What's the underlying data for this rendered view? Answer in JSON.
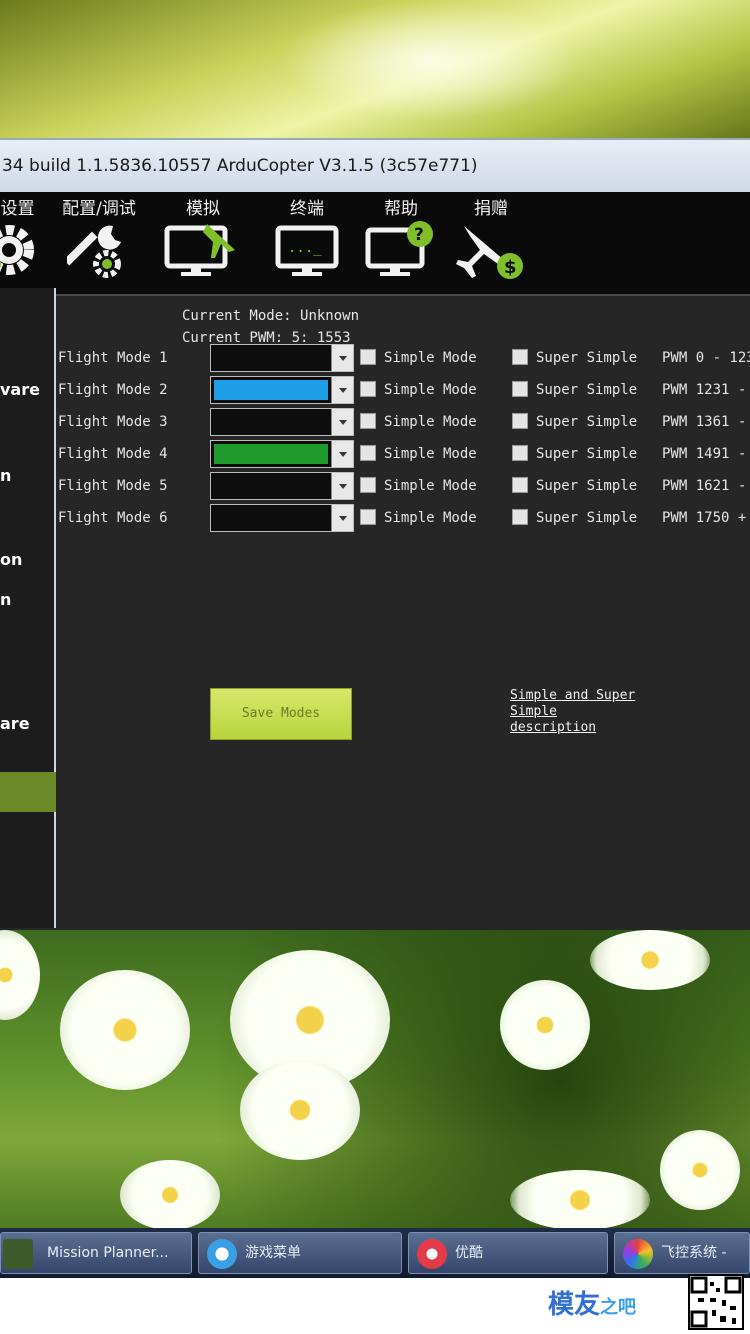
{
  "window": {
    "title": "34 build 1.1.5836.10557 ArduCopter V3.1.5 (3c57e771)"
  },
  "menu": {
    "items": [
      {
        "label": "台设置",
        "icon": "gear-icon"
      },
      {
        "label": "配置/调试",
        "icon": "wrench-gear-icon"
      },
      {
        "label": "模拟",
        "icon": "monitor-plane-icon"
      },
      {
        "label": "终端",
        "icon": "monitor-terminal-icon"
      },
      {
        "label": "帮助",
        "icon": "monitor-help-icon"
      },
      {
        "label": "捐赠",
        "icon": "plane-dollar-icon"
      }
    ]
  },
  "sidebar": {
    "items": [
      "vare",
      "n",
      "on",
      "n",
      "are"
    ]
  },
  "status": {
    "current_mode_label": "Current Mode:",
    "current_mode_value": "Unknown",
    "current_pwm_label": "Current PWM:",
    "current_pwm_value": "5: 1553"
  },
  "modes": [
    {
      "label": "Flight Mode 1",
      "simple": "Simple Mode",
      "super_simple": "Super Simple",
      "pwm": "PWM 0 - 123",
      "fill": "#0d0d0d"
    },
    {
      "label": "Flight Mode 2",
      "simple": "Simple Mode",
      "super_simple": "Super Simple",
      "pwm": "PWM 1231 -",
      "fill": "#1e9ee6"
    },
    {
      "label": "Flight Mode 3",
      "simple": "Simple Mode",
      "super_simple": "Super Simple",
      "pwm": "PWM 1361 -",
      "fill": "#0d0d0d"
    },
    {
      "label": "Flight Mode 4",
      "simple": "Simple Mode",
      "super_simple": "Super Simple",
      "pwm": "PWM 1491 -",
      "fill": "#1f9a2c"
    },
    {
      "label": "Flight Mode 5",
      "simple": "Simple Mode",
      "super_simple": "Super Simple",
      "pwm": "PWM 1621 -",
      "fill": "#0d0d0d"
    },
    {
      "label": "Flight Mode 6",
      "simple": "Simple Mode",
      "super_simple": "Super Simple",
      "pwm": "PWM 1750 +",
      "fill": "#0d0d0d"
    }
  ],
  "save_button": "Save Modes",
  "description_link": "Simple and Super Simple description",
  "taskbar": {
    "items": [
      {
        "label": "Mission Planner..."
      },
      {
        "label": "游戏菜单"
      },
      {
        "label": "优酷"
      },
      {
        "label": "飞控系统 -"
      }
    ]
  },
  "watermark": {
    "main": "模友",
    "sub": "之吧"
  }
}
